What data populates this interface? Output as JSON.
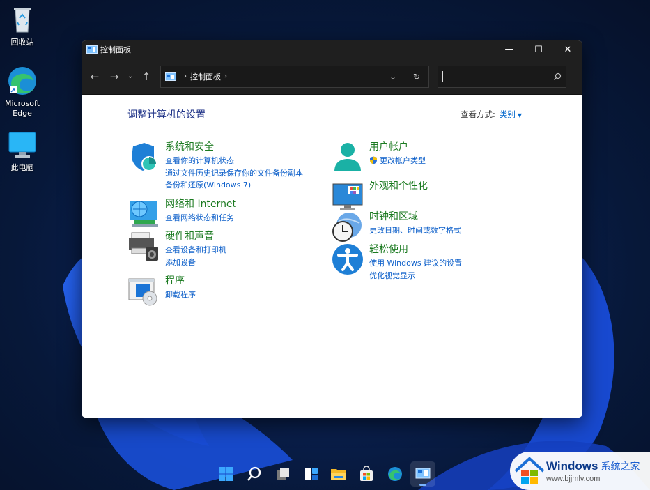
{
  "desktop": {
    "icons": [
      {
        "label": "回收站",
        "icon": "recycle-bin-icon"
      },
      {
        "label": "Microsoft\nEdge",
        "icon": "edge-icon"
      },
      {
        "label": "此电脑",
        "icon": "this-pc-icon"
      }
    ]
  },
  "window": {
    "title": "控制面板",
    "controls": {
      "minimize": "—",
      "maximize": "☐",
      "close": "✕"
    },
    "nav": {
      "back": "←",
      "forward": "→",
      "recent": "⌄",
      "up": "↑"
    },
    "address": {
      "crumbs": [
        "控制面板"
      ],
      "separator": "›",
      "dropdown": "⌄",
      "refresh": "↻"
    },
    "search": {
      "value": "",
      "placeholder": "",
      "icon": "search-icon"
    }
  },
  "content": {
    "heading": "调整计算机的设置",
    "view_by_label": "查看方式:",
    "view_by_value": "类别",
    "categories_left": [
      {
        "title": "系统和安全",
        "icon": "shield-icon",
        "links": [
          "查看你的计算机状态",
          "通过文件历史记录保存你的文件备份副本",
          "备份和还原(Windows 7)"
        ]
      },
      {
        "title": "网络和 Internet",
        "icon": "network-globe-icon",
        "links": [
          "查看网络状态和任务"
        ]
      },
      {
        "title": "硬件和声音",
        "icon": "printer-speaker-icon",
        "links": [
          "查看设备和打印机",
          "添加设备"
        ]
      },
      {
        "title": "程序",
        "icon": "programs-disc-icon",
        "links": [
          "卸载程序"
        ]
      }
    ],
    "categories_right": [
      {
        "title": "用户帐户",
        "icon": "user-accounts-icon",
        "links": [
          "更改帐户类型"
        ]
      },
      {
        "title": "外观和个性化",
        "icon": "appearance-monitor-icon",
        "links": []
      },
      {
        "title": "时钟和区域",
        "icon": "clock-globe-icon",
        "links": [
          "更改日期、时间或数字格式"
        ]
      },
      {
        "title": "轻松使用",
        "icon": "accessibility-icon",
        "links": [
          "使用 Windows 建议的设置",
          "优化视觉显示"
        ]
      }
    ]
  },
  "taskbar": {
    "items": [
      "start-icon",
      "search-icon",
      "task-view-icon",
      "widgets-icon",
      "file-explorer-icon",
      "store-icon",
      "edge-icon",
      "control-panel-icon"
    ]
  },
  "watermark": {
    "brand": "Windows",
    "brand_cn": "系统之家",
    "url": "www.bjjmlv.com"
  },
  "colors": {
    "link": "#0b5ec9",
    "category_title": "#1b7a20",
    "heading": "#1e3287",
    "titlebar": "#1f1f1f"
  }
}
